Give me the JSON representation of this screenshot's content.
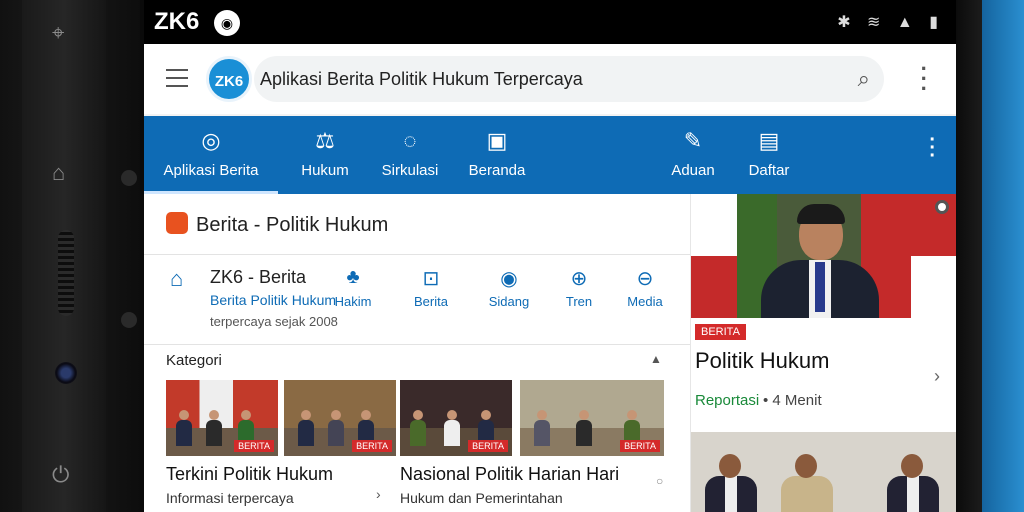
{
  "status": {
    "carrier": "ZK6",
    "cat_glyph": "◉",
    "indicators": "✱ ≋ ▲ ▮"
  },
  "appbar": {
    "logo": "ZK6",
    "title": "Aplikasi Berita Politik Hukum Terpercaya"
  },
  "nav": {
    "items": [
      {
        "label": "Aplikasi Berita",
        "icon": "eye-icon",
        "glyph": "◎"
      },
      {
        "label": "Hukum",
        "icon": "gavel-icon",
        "glyph": "⚖"
      },
      {
        "label": "Sirkulasi",
        "icon": "circle-icon",
        "glyph": "◌"
      },
      {
        "label": "Beranda",
        "icon": "home-icon",
        "glyph": "▣"
      },
      {
        "label": "Aduan",
        "icon": "flag-icon",
        "glyph": "✎"
      },
      {
        "label": "Daftar",
        "icon": "clipboard-icon",
        "glyph": "▤"
      }
    ]
  },
  "section": {
    "title": "Berita - Politik Hukum"
  },
  "org": {
    "icon_glyph": "⌂",
    "name": "ZK6 - Berita",
    "subtitle": "Berita Politik Hukum",
    "detail": "terpercaya sejak 2008"
  },
  "quick": [
    {
      "label": "Hakim",
      "glyph": "♣",
      "icon": "gavel-icon"
    },
    {
      "label": "Berita",
      "glyph": "⊡",
      "icon": "news-icon"
    },
    {
      "label": "Sidang",
      "glyph": "◉",
      "icon": "court-icon"
    },
    {
      "label": "Tren",
      "glyph": "⊕",
      "icon": "trend-icon"
    },
    {
      "label": "Media",
      "glyph": "⊖",
      "icon": "media-icon"
    }
  ],
  "category": {
    "title": "Kategori",
    "chevron": "▲"
  },
  "thumbs": [
    {
      "tag": "BERITA"
    },
    {
      "tag": "BERITA"
    },
    {
      "tag": "BERITA"
    },
    {
      "tag": "BERITA"
    }
  ],
  "articles": [
    {
      "title": "Terkini Politik Hukum",
      "subtitle": "Informasi terpercaya",
      "chevron": "›"
    },
    {
      "title": "Nasional Politik Harian Hari",
      "subtitle": "Hukum dan Pemerintahan",
      "dot": "○"
    }
  ],
  "feature": {
    "tag": "BERITA",
    "title": "Politik Hukum",
    "source": "Reportasi",
    "meta": "• 4 Menit",
    "chevron": "›"
  },
  "colors": {
    "brand_blue": "#0e6bb5",
    "accent_red": "#d42a2a",
    "source_green": "#1a8a3a"
  }
}
